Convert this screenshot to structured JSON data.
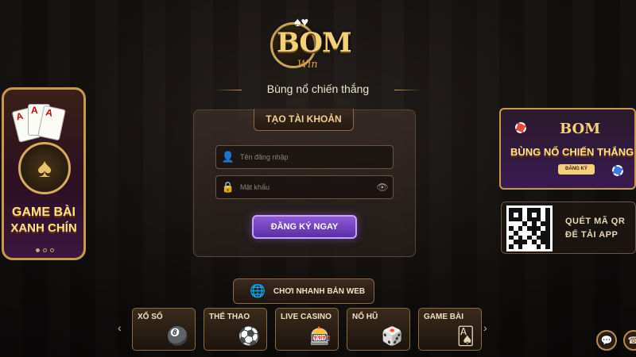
{
  "logo": {
    "main": "BOM",
    "sub": "Win",
    "cards_glyph": "♠♥"
  },
  "tagline": "Bùng nổ chiến thắng",
  "register": {
    "tab_label": "TẠO TÀI KHOẢN",
    "username_placeholder": "Tên đăng nhập",
    "password_placeholder": "Mật khẩu",
    "submit_label": "ĐĂNG KÝ NGAY",
    "icons": {
      "user": "user-icon",
      "lock": "lock-icon",
      "eye": "eye-icon"
    }
  },
  "web_play": {
    "label": "CHƠI NHANH BẢN WEB",
    "icon": "globe-icon"
  },
  "promo_left": {
    "title_line1": "GAME BÀI",
    "title_line2": "XANH CHÍN",
    "carousel_dots": [
      true,
      false,
      false
    ],
    "card_ranks": [
      "A",
      "A",
      "A"
    ]
  },
  "promo_right": {
    "logo": "BOM",
    "headline": "BÙNG NỔ CHIẾN THẮNG",
    "button_label": "ĐĂNG KÝ"
  },
  "qr": {
    "line1": "QUÉT MÃ QR",
    "line2": "ĐỂ TẢI APP"
  },
  "categories": [
    {
      "label": "XỔ SỐ",
      "art": "🎱"
    },
    {
      "label": "THỂ THAO",
      "art": "⚽"
    },
    {
      "label": "LIVE CASINO",
      "art": "🎰"
    },
    {
      "label": "NỔ HŨ",
      "art": "🎲"
    },
    {
      "label": "GAME BÀI",
      "art": "🂡"
    }
  ],
  "nav": {
    "prev": "‹",
    "next": "›"
  },
  "corner_buttons": [
    {
      "icon": "chat-icon",
      "glyph": "💬"
    },
    {
      "icon": "support-icon",
      "glyph": "☎"
    }
  ],
  "colors": {
    "gold": "#c9a35a",
    "purple": "#7a46c6",
    "accent_text": "#ffe38a"
  }
}
